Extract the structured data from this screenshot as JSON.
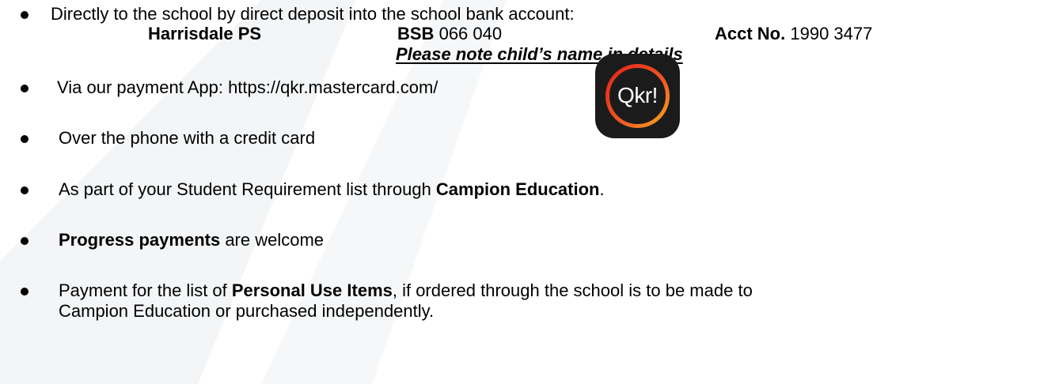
{
  "bank_item": {
    "text": "Directly to the school by direct deposit into the school bank account:",
    "account_name": "Harrisdale PS",
    "bsb_label": "BSB",
    "bsb_value": "066 040",
    "acct_label": "Acct No.",
    "acct_value": "1990 3477",
    "note": "Please note child’s name in details"
  },
  "app_item": {
    "text": "Via our payment App: https://qkr.mastercard.com/",
    "logo_text": "Qkr!"
  },
  "phone_item": {
    "text": "Over the phone with a credit card"
  },
  "campion_item": {
    "text_before": "As part of your Student Requirement list through ",
    "bold": "Campion Education",
    "text_after": "."
  },
  "progress_item": {
    "bold": "Progress payments",
    "text_after": " are welcome"
  },
  "personal_item": {
    "text_before": "Payment for the list of ",
    "bold": "Personal Use Items",
    "text_after": ", if ordered through the school is to be made to",
    "line2": "Campion Education or purchased independently."
  },
  "colors": {
    "text": "#000000",
    "watermark": "#f2f4f6",
    "logo_background": "#1b1b1b",
    "logo_ring_start": "#e2231a",
    "logo_ring_end": "#f8a81d"
  }
}
